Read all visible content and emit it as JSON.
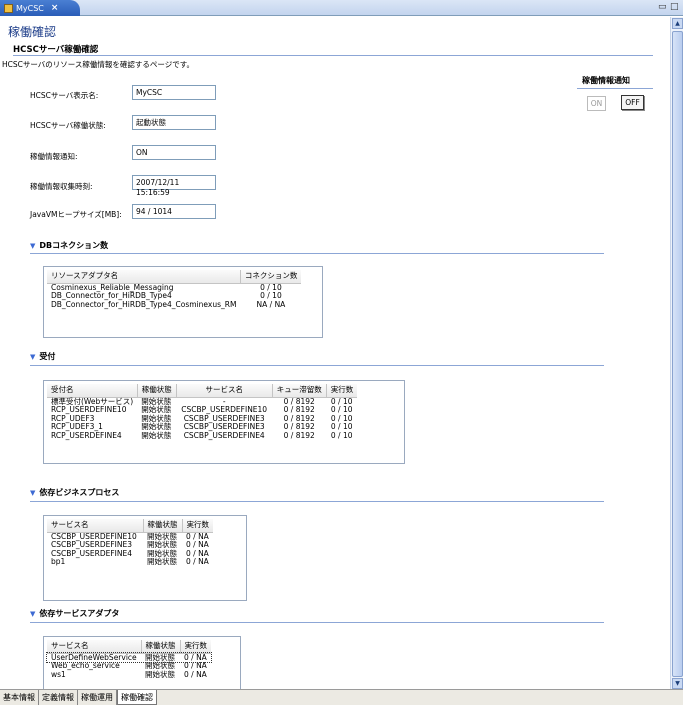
{
  "editor": {
    "tab_title": "MyCSC",
    "tab_close": "×",
    "minimize": "▭",
    "maximize": "□"
  },
  "page": {
    "title": "稼働確認",
    "section_title": "HCSCサーバ稼働確認",
    "description": "HCSCサーバのリソース稼働情報を確認するページです。"
  },
  "fields": [
    {
      "label": "HCSCサーバ表示名:",
      "value": "MyCSC"
    },
    {
      "label": "HCSCサーバ稼働状態:",
      "value": "起動状態"
    },
    {
      "label": "稼働情報通知:",
      "value": "ON"
    },
    {
      "label": "稼働情報収集時刻:",
      "value": "2007/12/11 15:16:59"
    },
    {
      "label": "JavaVMヒープサイズ[MB]:",
      "value": "94 / 1014"
    }
  ],
  "notify": {
    "title": "稼働情報通知",
    "on_label": "ON",
    "off_label": "OFF"
  },
  "db": {
    "heading": "DBコネクション数",
    "columns": [
      "リソースアダプタ名",
      "コネクション数"
    ],
    "rows": [
      [
        "Cosminexus_Reliable_Messaging",
        "0 / 10"
      ],
      [
        "DB_Connector_for_HiRDB_Type4",
        "0 / 10"
      ],
      [
        "DB_Connector_for_HiRDB_Type4_Cosminexus_RM",
        "NA / NA"
      ]
    ]
  },
  "reception": {
    "heading": "受付",
    "columns": [
      "受付名",
      "稼働状態",
      "サービス名",
      "キュー滞留数",
      "実行数"
    ],
    "rows": [
      [
        "標準受付(Webサービス)",
        "開始状態",
        "-",
        "0 / 8192",
        "0 / 10"
      ],
      [
        "RCP_USERDEFINE10",
        "開始状態",
        "CSCBP_USERDEFINE10",
        "0 / 8192",
        "0 / 10"
      ],
      [
        "RCP_UDEF3",
        "開始状態",
        "CSCBP_USERDEFINE3",
        "0 / 8192",
        "0 / 10"
      ],
      [
        "RCP_UDEF3_1",
        "開始状態",
        "CSCBP_USERDEFINE3",
        "0 / 8192",
        "0 / 10"
      ],
      [
        "RCP_USERDEFINE4",
        "開始状態",
        "CSCBP_USERDEFINE4",
        "0 / 8192",
        "0 / 10"
      ]
    ]
  },
  "bizprocess": {
    "heading": "依存ビジネスプロセス",
    "columns": [
      "サービス名",
      "稼働状態",
      "実行数"
    ],
    "rows": [
      [
        "CSCBP_USERDEFINE10",
        "開始状態",
        "0 / NA"
      ],
      [
        "CSCBP_USERDEFINE3",
        "開始状態",
        "0 / NA"
      ],
      [
        "CSCBP_USERDEFINE4",
        "開始状態",
        "0 / NA"
      ],
      [
        "bp1",
        "開始状態",
        "0 / NA"
      ]
    ]
  },
  "adapters": {
    "heading": "依存サービスアダプタ",
    "columns": [
      "サービス名",
      "稼働状態",
      "実行数"
    ],
    "rows": [
      [
        "UserDefineWebService",
        "開始状態",
        "0 / NA"
      ],
      [
        "Web_echo_service",
        "開始状態",
        "0 / NA"
      ],
      [
        "ws1",
        "開始状態",
        "0 / NA"
      ]
    ]
  },
  "bottom_tabs": [
    "基本情報",
    "定義情報",
    "稼働運用",
    "稼働確認"
  ],
  "colors": {
    "accent": "#1e3e8a",
    "rule": "#8ca6d6",
    "tab": "#2a5db8"
  }
}
